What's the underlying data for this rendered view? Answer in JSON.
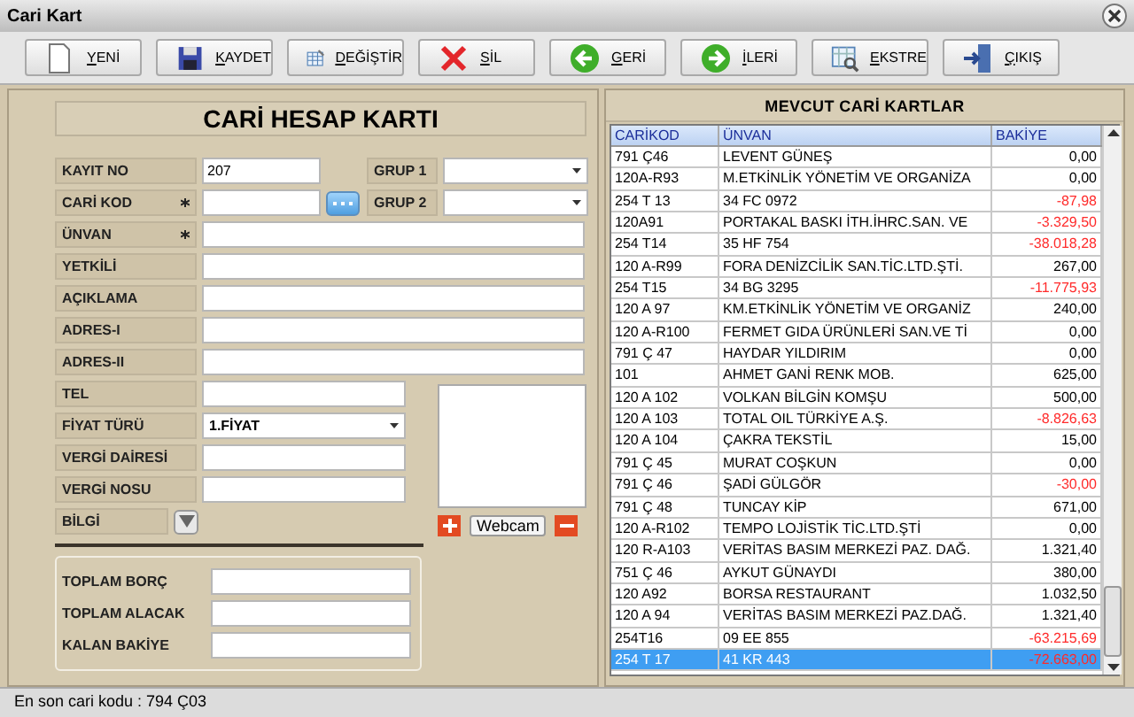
{
  "window": {
    "title": "Cari Kart"
  },
  "toolbar": [
    {
      "label": "YENİ"
    },
    {
      "label": "KAYDET"
    },
    {
      "label": "DEĞİŞTİR"
    },
    {
      "label": "SİL"
    },
    {
      "label": "GERİ"
    },
    {
      "label": "İLERİ"
    },
    {
      "label": "EKSTRE"
    },
    {
      "label": "ÇIKIŞ"
    }
  ],
  "form": {
    "title": "CARİ HESAP KARTI",
    "fields": [
      {
        "label": "KAYIT NO",
        "kind": "short",
        "required": false,
        "value": "207"
      },
      {
        "label": "CARİ KOD",
        "kind": "lookup",
        "required": true
      },
      {
        "label": "ÜNVAN",
        "kind": "wide",
        "required": true
      },
      {
        "label": "YETKİLİ",
        "kind": "wide",
        "required": false
      },
      {
        "label": "AÇIKLAMA",
        "kind": "wide",
        "required": false
      },
      {
        "label": "ADRES-I",
        "kind": "wide",
        "required": false
      },
      {
        "label": "ADRES-II",
        "kind": "wide",
        "required": false
      },
      {
        "label": "TEL",
        "kind": "medium",
        "required": false
      },
      {
        "label": "FİYAT TÜRÜ",
        "kind": "combo",
        "required": false,
        "value": "1.FİYAT"
      },
      {
        "label": "VERGİ DAİRESİ",
        "kind": "medium",
        "required": false
      },
      {
        "label": "VERGİ NOSU",
        "kind": "medium",
        "required": false
      },
      {
        "label": "BİLGİ",
        "kind": "toggle",
        "required": false
      }
    ],
    "groups": [
      {
        "label": "GRUP 1"
      },
      {
        "label": "GRUP 2"
      }
    ],
    "webcam_button": "Webcam",
    "totals": [
      {
        "label": "TOPLAM BORÇ"
      },
      {
        "label": "TOPLAM ALACAK"
      },
      {
        "label": "KALAN BAKİYE"
      }
    ]
  },
  "list": {
    "title": "MEVCUT CARİ KARTLAR",
    "columns": [
      "CARİKOD",
      "ÜNVAN",
      "BAKİYE"
    ],
    "rows": [
      {
        "cells": [
          "791 Ç46",
          "LEVENT GÜNEŞ",
          "0,00"
        ],
        "negative": false,
        "selected": false
      },
      {
        "cells": [
          "120A-R93",
          "M.ETKİNLİK YÖNETİM VE ORGANİZA",
          "0,00"
        ],
        "negative": false,
        "selected": false
      },
      {
        "cells": [
          "254 T 13",
          "34 FC 0972",
          "-87,98"
        ],
        "negative": true,
        "selected": false
      },
      {
        "cells": [
          "120A91",
          "PORTAKAL BASKI İTH.İHRC.SAN. VE",
          "-3.329,50"
        ],
        "negative": true,
        "selected": false
      },
      {
        "cells": [
          "254 T14",
          "35 HF 754",
          "-38.018,28"
        ],
        "negative": true,
        "selected": false
      },
      {
        "cells": [
          "120 A-R99",
          "FORA DENİZCİLİK SAN.TİC.LTD.ŞTİ.",
          "267,00"
        ],
        "negative": false,
        "selected": false
      },
      {
        "cells": [
          "254 T15",
          "34 BG 3295",
          "-11.775,93"
        ],
        "negative": true,
        "selected": false
      },
      {
        "cells": [
          "120 A 97",
          "KM.ETKİNLİK YÖNETİM VE ORGANİZ",
          "240,00"
        ],
        "negative": false,
        "selected": false
      },
      {
        "cells": [
          "120 A-R100",
          "FERMET GIDA ÜRÜNLERİ SAN.VE Tİ",
          "0,00"
        ],
        "negative": false,
        "selected": false
      },
      {
        "cells": [
          "791 Ç 47",
          "HAYDAR YILDIRIM",
          "0,00"
        ],
        "negative": false,
        "selected": false
      },
      {
        "cells": [
          "101",
          "AHMET GANİ RENK MOB.",
          "625,00"
        ],
        "negative": false,
        "selected": false
      },
      {
        "cells": [
          "120 A 102",
          "VOLKAN BİLGİN KOMŞU",
          "500,00"
        ],
        "negative": false,
        "selected": false
      },
      {
        "cells": [
          "120 A 103",
          "TOTAL OIL TÜRKİYE A.Ş.",
          "-8.826,63"
        ],
        "negative": true,
        "selected": false
      },
      {
        "cells": [
          "120 A 104",
          "ÇAKRA TEKSTİL",
          "15,00"
        ],
        "negative": false,
        "selected": false
      },
      {
        "cells": [
          "791 Ç 45",
          "MURAT COŞKUN",
          "0,00"
        ],
        "negative": false,
        "selected": false
      },
      {
        "cells": [
          "791 Ç 46",
          "ŞADİ GÜLGÖR",
          "-30,00"
        ],
        "negative": true,
        "selected": false
      },
      {
        "cells": [
          "791 Ç 48",
          "TUNCAY KİP",
          "671,00"
        ],
        "negative": false,
        "selected": false
      },
      {
        "cells": [
          "120 A-R102",
          "TEMPO LOJİSTİK TİC.LTD.ŞTİ",
          "0,00"
        ],
        "negative": false,
        "selected": false
      },
      {
        "cells": [
          "120 R-A103",
          "VERİTAS BASIM MERKEZİ PAZ. DAĞ.",
          "1.321,40"
        ],
        "negative": false,
        "selected": false
      },
      {
        "cells": [
          "751 Ç 46",
          "AYKUT GÜNAYDI",
          "380,00"
        ],
        "negative": false,
        "selected": false
      },
      {
        "cells": [
          "120 A92",
          "BORSA RESTAURANT",
          "1.032,50"
        ],
        "negative": false,
        "selected": false
      },
      {
        "cells": [
          "120 A 94",
          "VERİTAS BASIM MERKEZİ PAZ.DAĞ.",
          "1.321,40"
        ],
        "negative": false,
        "selected": false
      },
      {
        "cells": [
          "254T16",
          "09 EE 855",
          "-63.215,69"
        ],
        "negative": true,
        "selected": false
      },
      {
        "cells": [
          "254 T 17",
          "41 KR 443",
          "-72.663,00"
        ],
        "negative": true,
        "selected": true
      }
    ]
  },
  "status_bar": "En son cari kodu : 794 Ç03"
}
